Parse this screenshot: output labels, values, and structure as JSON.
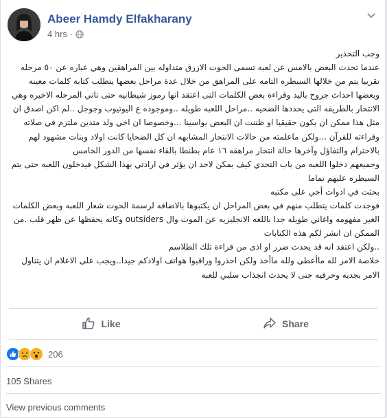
{
  "post": {
    "author": "Abeer Hamdy Elfakharany",
    "time": "4 hrs",
    "separator": "·",
    "paragraphs": [
      "وجب التحذير",
      "عندما تحدث البعض بالامس عن لعبه تسمى الحوت الازرق متداوله بين المراهقين وهي عباره عن ٥٠ مرحله تقريبا يتم من خلالها السيطره التامه على المراهق من خلال عدة مراحل بعضها يتطلب كتابة كلمات معينه وبعضها احداث جروح باليد وقراءة بعض الكلمات التى اعتقد انها رموز شيطانيه حتى تاتي المرحله الاخيره وهي الانتحار بالطريقه التى يحددها الضحيه ..مراحل اللعبه طويله ..وموجوده ع اليوتيوب وجوجل ..لم اكن اصدق ان مثل هذا ممكن ان يكون حقيقيا او ظننت ان البعض يواسينا ...وخصوصا ان اخي ولد متدين ملتزم في صلاته وقراءته للقرآن ...ولكن ماعلمته من حالات الانتحار المشابهه ان كل الضحايا كانت اولاد وبنات مشهود لهم بالاحترام والتفاؤل وآخرها حالة انتحار مراهقه ١٦ عام بطنطا بالقاء نفسها من الدور الخامس",
      "وجميعهم دخلوا اللعبه من باب التحدي كيف يمكن لاحد ان يؤثر في ارادتي بهذا الشكل فيدخلون اللعبه حتى يتم السيطره عليهم تماما",
      "بحثت في ادوات أخي على مكتبه",
      "فوجدت كلمات يتطلب منهم في بعض المراحل ان يكتبوها بالاضافه لرسمة الحوت شعار اللعبه وبعض الكلمات الغير مفهومه واغاني طويله جدا باللغه الانجليزيه عن الموت وال outsiders وكانه يحفظها عن ظهر قلب .من الممكن ان انشر لكم هذه الكتابات",
      "..ولكن اعتقد انه قد يحدث ضرر او اذى من قراءة تلك الطلاسم",
      "خلاصة الامر لله ماأعطى ولله ماأخذ ولكن احذروا وراقبوا هواتف اولادكم جيدا..ويجب على الاعلام ان يتناول الامر بجديه وحرفيه حتى لا يحدث انجذاب سلبي للعبه"
    ]
  },
  "actions": {
    "like_label": "Like",
    "share_label": "Share"
  },
  "stats": {
    "reaction_count": "206",
    "shares": "105 Shares",
    "view_previous": "View previous comments"
  },
  "colors": {
    "author": "#365899",
    "like_blue": "#1877f2",
    "emoji_yellow": "#f7b125"
  },
  "icons": {
    "globe": "globe-icon",
    "chevron": "chevron-down-icon",
    "like": "thumbs-up-icon",
    "share": "share-arrow-icon"
  }
}
